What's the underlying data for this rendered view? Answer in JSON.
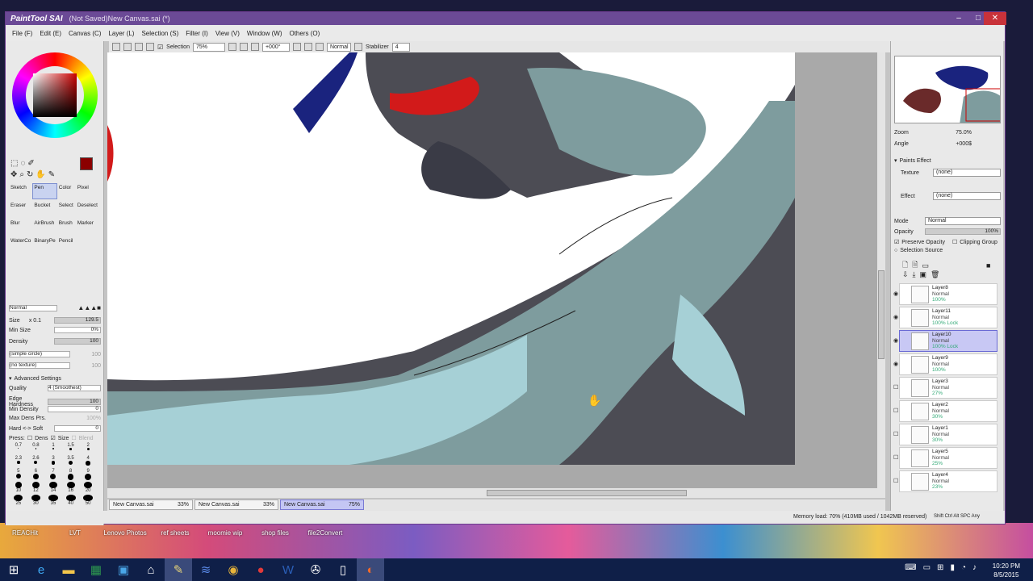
{
  "window": {
    "logo": "PaintTool SAI",
    "title": "(Not Saved)New Canvas.sai (*)"
  },
  "menu": [
    "File (F)",
    "Edit (E)",
    "Canvas (C)",
    "Layer (L)",
    "Selection (S)",
    "Filter (I)",
    "View (V)",
    "Window (W)",
    "Others (O)"
  ],
  "toolbar": {
    "selection_label": "Selection",
    "zoom": "75%",
    "angle": "+000°",
    "mode": "Normal",
    "stabilizer_label": "Stabilizer",
    "stabilizer_value": "4"
  },
  "tools": [
    {
      "label": "Sketch",
      "selected": false
    },
    {
      "label": "Pen",
      "selected": true
    },
    {
      "label": "Color",
      "selected": false
    },
    {
      "label": "Pixel",
      "selected": false
    },
    {
      "label": "Eraser",
      "selected": false
    },
    {
      "label": "Bucket",
      "selected": false
    },
    {
      "label": "Select",
      "selected": false
    },
    {
      "label": "Deselect",
      "selected": false
    },
    {
      "label": "Blur",
      "selected": false
    },
    {
      "label": "AirBrush",
      "selected": false
    },
    {
      "label": "Brush",
      "selected": false
    },
    {
      "label": "Marker",
      "selected": false
    },
    {
      "label": "WaterCo",
      "selected": false
    },
    {
      "label": "BinaryPe",
      "selected": false
    },
    {
      "label": "Pencil",
      "selected": false
    },
    {
      "label": "",
      "selected": false
    }
  ],
  "brush": {
    "blend_mode": "Normal",
    "size_label": "Size",
    "size_mult": "x 0.1",
    "size_value": "129.5",
    "min_size_label": "Min Size",
    "min_size_value": "0%",
    "density_label": "Density",
    "density_value": "100",
    "shape": "(simple circle)",
    "shape_value": "100",
    "texture": "(no texture)",
    "texture_value": "100",
    "advanced_label": "Advanced Settings",
    "quality_label": "Quality",
    "quality_value": "4 (Smoothest)",
    "edge_label": "Edge Hardness",
    "edge_value": "100",
    "min_density_label": "Min Density",
    "min_density_value": "0",
    "max_dens_label": "Max Dens Prs.",
    "max_dens_value": "100%",
    "hard_soft_label": "Hard <-> Soft",
    "hard_soft_value": "0",
    "press_label": "Press:",
    "dens_label": "Dens",
    "size_check_label": "Size",
    "blend_label": "Blend"
  },
  "brush_sizes": [
    "0.7",
    "0.8",
    "1",
    "1.5",
    "2",
    "2.3",
    "2.6",
    "3",
    "3.5",
    "4",
    "5",
    "6",
    "7",
    "8",
    "9",
    "10",
    "12",
    "14",
    "16",
    "20",
    "25",
    "30",
    "35",
    "40",
    "50"
  ],
  "colors": {
    "primary": "#8b0000",
    "accent": "#6b4a96",
    "canvas_bg": "#ffffff",
    "fur_dark": "#4a4a52",
    "fur_mid": "#7e9c9e",
    "fur_light": "#a6d0d6",
    "blue": "#1a237e",
    "red": "#d21a1a"
  },
  "tabs": [
    {
      "name": "New Canvas.sai",
      "zoom": "33%",
      "active": false
    },
    {
      "name": "New Canvas.sai",
      "zoom": "33%",
      "active": false
    },
    {
      "name": "New Canvas.sai",
      "zoom": "75%",
      "active": true
    }
  ],
  "status": {
    "memory": "Memory load: 70% (410MB used / 1042MB reserved)",
    "keys": "Shift Ctrl Alt SPC Any"
  },
  "navigator": {
    "zoom_label": "Zoom",
    "zoom_value": "75.0%",
    "angle_label": "Angle",
    "angle_value": "+000$"
  },
  "paints": {
    "section_label": "Paints Effect",
    "texture_label": "Texture",
    "texture_value": "(none)",
    "effect_label": "Effect",
    "effect_value": "(none)",
    "mode_label": "Mode",
    "mode_value": "Normal",
    "opacity_label": "Opacity",
    "opacity_value": "100%",
    "preserve_label": "Preserve Opacity",
    "clipping_label": "Clipping Group",
    "source_label": "Selection Source"
  },
  "layers": [
    {
      "name": "Layer8",
      "mode": "Normal",
      "opacity": "100%",
      "visible": true,
      "active": false
    },
    {
      "name": "Layer11",
      "mode": "Normal",
      "opacity": "100% Lock",
      "visible": true,
      "active": false
    },
    {
      "name": "Layer10",
      "mode": "Normal",
      "opacity": "100% Lock",
      "visible": true,
      "active": true
    },
    {
      "name": "Layer9",
      "mode": "Normal",
      "opacity": "100%",
      "visible": true,
      "active": false
    },
    {
      "name": "Layer3",
      "mode": "Normal",
      "opacity": "27%",
      "visible": false,
      "active": false
    },
    {
      "name": "Layer2",
      "mode": "Normal",
      "opacity": "30%",
      "visible": false,
      "active": false
    },
    {
      "name": "Layer1",
      "mode": "Normal",
      "opacity": "30%",
      "visible": false,
      "active": false
    },
    {
      "name": "Layer5",
      "mode": "Normal",
      "opacity": "25%",
      "visible": false,
      "active": false
    },
    {
      "name": "Layer4",
      "mode": "Normal",
      "opacity": "23%",
      "visible": false,
      "active": false
    }
  ],
  "desktop_icons": [
    "REACHit",
    "LVT",
    "Lenovo Photos",
    "ref sheets",
    "moomie wip",
    "shop files",
    "file2Convert"
  ],
  "taskbar": {
    "time": "10:20 PM",
    "date": "8/5/2015"
  }
}
